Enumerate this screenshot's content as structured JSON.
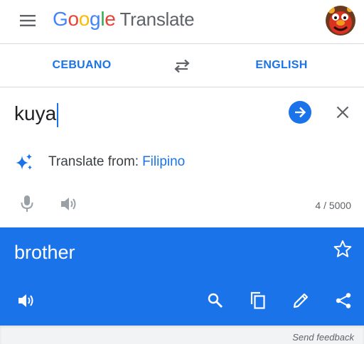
{
  "app": {
    "logo_letters": [
      "G",
      "o",
      "o",
      "g",
      "l",
      "e"
    ],
    "logo_colors": [
      "#4285F4",
      "#EA4335",
      "#FBBC05",
      "#4285F4",
      "#34A853",
      "#EA4335"
    ],
    "product_name": "Translate"
  },
  "languages": {
    "source": "CEBUANO",
    "target": "ENGLISH"
  },
  "input": {
    "text": "kuya",
    "detect_label": "Translate from:",
    "detect_language": "Filipino",
    "char_count": "4 / 5000"
  },
  "output": {
    "text": "brother"
  },
  "footer": {
    "feedback": "Send feedback"
  },
  "colors": {
    "accent": "#1a73e8",
    "icon_grey": "#5f6368",
    "icon_light_grey": "#9aa0a6"
  },
  "icons": {
    "menu": "menu-icon",
    "swap": "swap-icon",
    "go": "arrow-forward-icon",
    "clear": "close-icon",
    "sparkle": "sparkle-icon",
    "mic": "microphone-icon",
    "speaker": "speaker-icon",
    "star": "star-icon",
    "search": "search-icon",
    "copy": "copy-icon",
    "edit": "pencil-icon",
    "share": "share-icon"
  }
}
